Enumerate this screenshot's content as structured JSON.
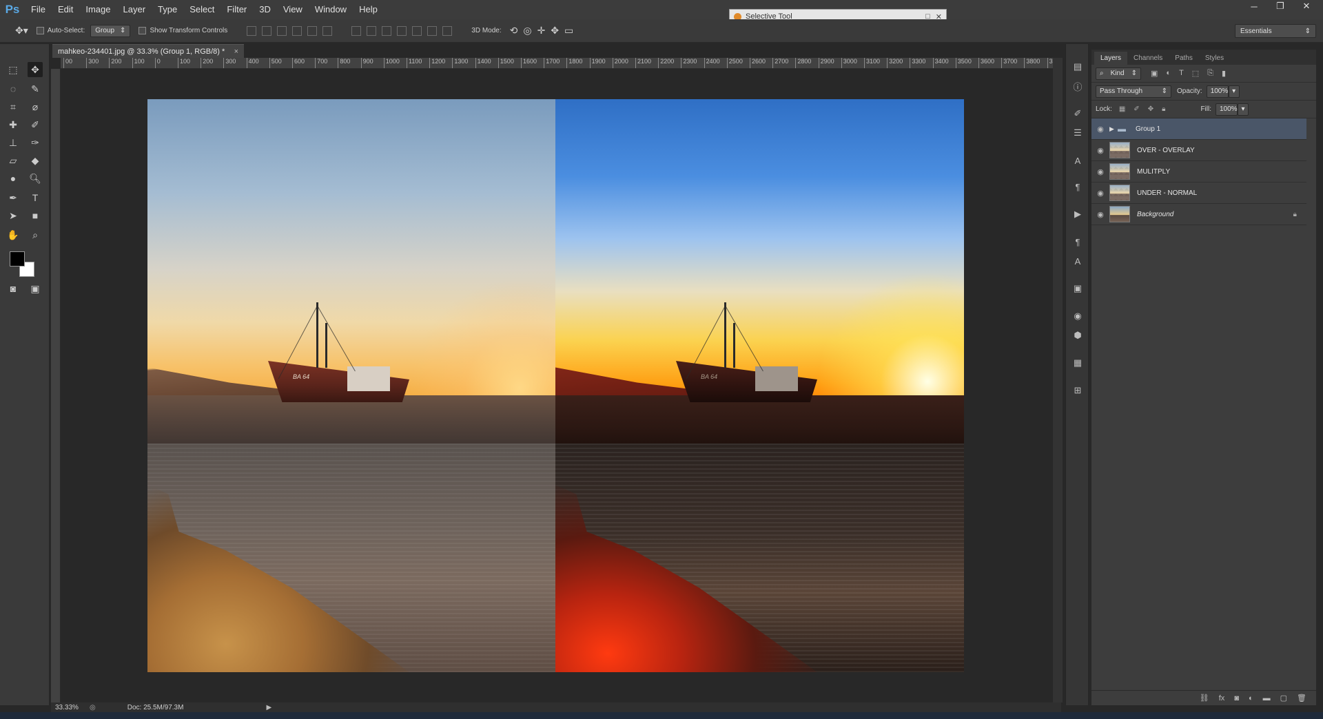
{
  "app": {
    "logo": "Ps"
  },
  "menu": [
    "File",
    "Edit",
    "Image",
    "Layer",
    "Type",
    "Select",
    "Filter",
    "3D",
    "View",
    "Window",
    "Help"
  ],
  "window_controls": {
    "minimize": "─",
    "restore": "❐",
    "close": "✕"
  },
  "selective_tool": {
    "title": "Selective Tool",
    "restore_glyph": "□",
    "close_glyph": "✕"
  },
  "options_bar": {
    "auto_select_label": "Auto-Select:",
    "auto_select_value": "Group",
    "show_transform_label": "Show Transform Controls",
    "mode_3d_label": "3D Mode:",
    "workspace": "Essentials"
  },
  "document_tab": {
    "title": "mahkeo-234401.jpg @ 33.3% (Group 1, RGB/8) *",
    "close": "×"
  },
  "ruler": {
    "ticks": [
      "00",
      "300",
      "200",
      "100",
      "0",
      "100",
      "200",
      "300",
      "400",
      "500",
      "600",
      "700",
      "800",
      "900",
      "1000",
      "1100",
      "1200",
      "1300",
      "1400",
      "1500",
      "1600",
      "1700",
      "1800",
      "1900",
      "2000",
      "2100",
      "2200",
      "2300",
      "2400",
      "2500",
      "2600",
      "2700",
      "2800",
      "2900",
      "3000",
      "3100",
      "3200",
      "3300",
      "3400",
      "3500",
      "3600",
      "3700",
      "3800",
      "39"
    ]
  },
  "layers_panel": {
    "tabs": [
      "Layers",
      "Channels",
      "Paths",
      "Styles"
    ],
    "active_tab": "Layers",
    "filter_label": "Kind",
    "blend_mode": "Pass Through",
    "opacity_label": "Opacity:",
    "opacity_value": "100%",
    "lock_label": "Lock:",
    "fill_label": "Fill:",
    "fill_value": "100%",
    "layers": [
      {
        "name": "Group 1",
        "type": "group",
        "selected": true
      },
      {
        "name": "OVER - OVERLAY",
        "type": "layer"
      },
      {
        "name": "MULITPLY",
        "type": "layer"
      },
      {
        "name": "UNDER - NORMAL",
        "type": "layer"
      },
      {
        "name": "Background",
        "type": "background",
        "locked": true
      }
    ],
    "bottom_icons": [
      "link-icon",
      "fx-icon",
      "mask-icon",
      "adjustment-icon",
      "folder-icon",
      "new-layer-icon",
      "trash-icon"
    ]
  },
  "status": {
    "zoom": "33.33%",
    "doc": "Doc: 25.5M/97.3M"
  },
  "photo": {
    "boat_marking": "BA 64"
  }
}
